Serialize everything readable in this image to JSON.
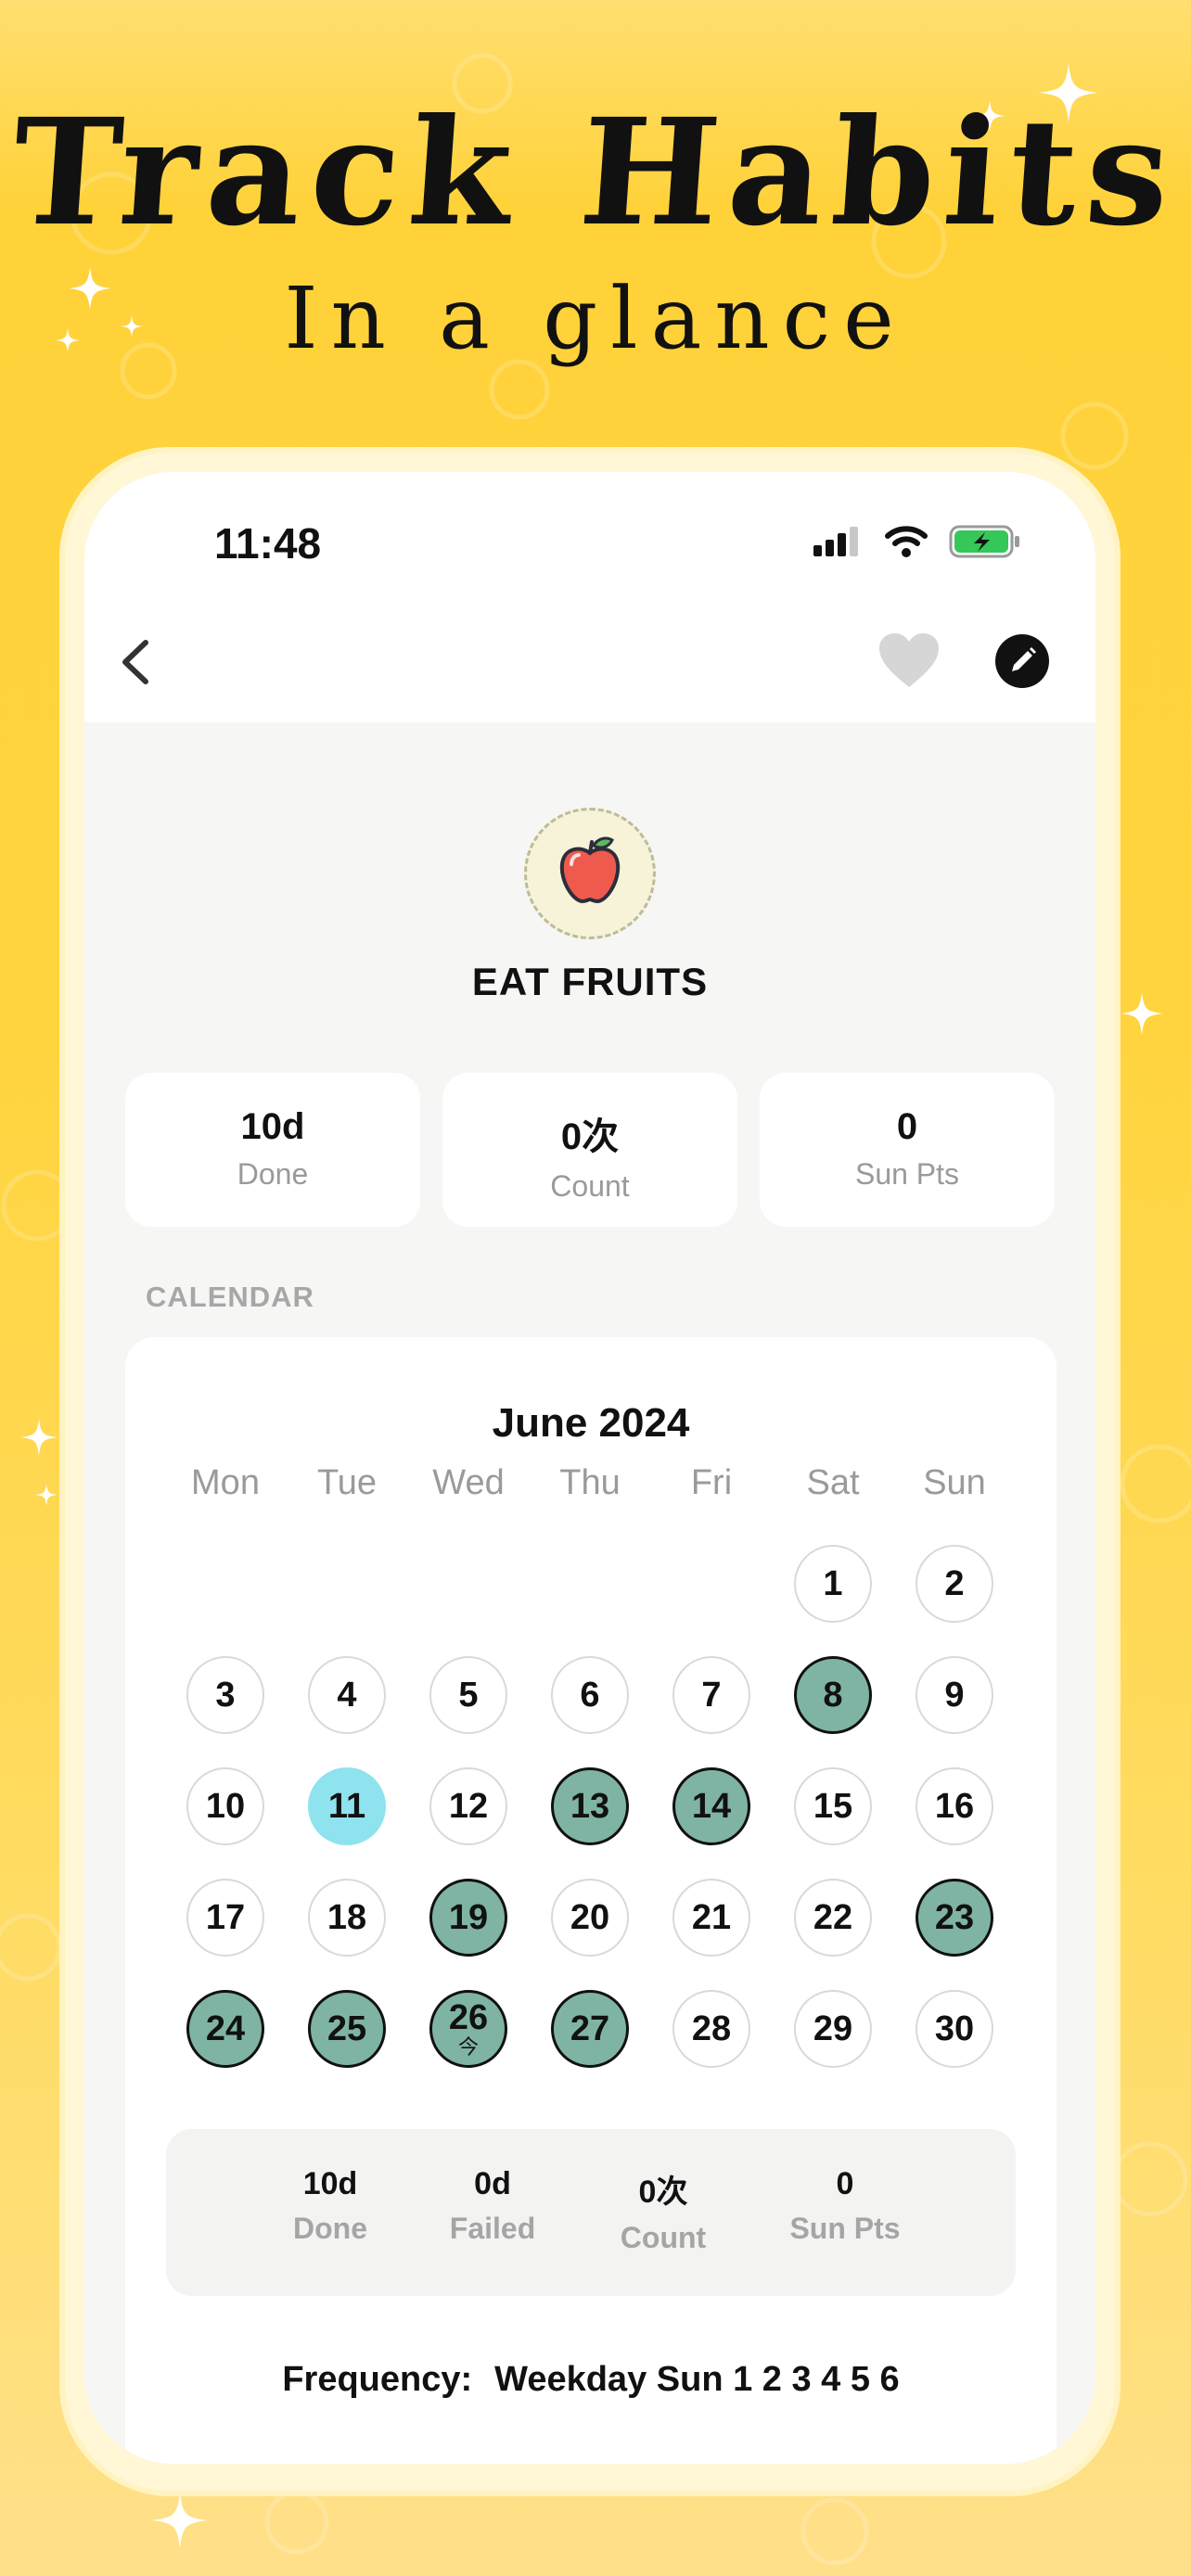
{
  "promo": {
    "headline": "Track Habits",
    "subheadline": "In a glance"
  },
  "status_bar": {
    "time": "11:48"
  },
  "nav": {
    "back_icon": "chevron-left-icon",
    "favorite_icon": "heart-icon",
    "edit_icon": "pencil-icon"
  },
  "habit": {
    "icon": "apple-icon",
    "name": "EAT FRUITS"
  },
  "stats": [
    {
      "value": "10d",
      "label": "Done"
    },
    {
      "value": "0次",
      "label": "Count"
    },
    {
      "value": "0",
      "label": "Sun Pts"
    }
  ],
  "calendar": {
    "section_label": "CALENDAR",
    "month_title": "June 2024",
    "weekdays": [
      "Mon",
      "Tue",
      "Wed",
      "Thu",
      "Fri",
      "Sat",
      "Sun"
    ],
    "days": [
      {
        "n": "1"
      },
      {
        "n": "2"
      },
      {
        "n": "3"
      },
      {
        "n": "4"
      },
      {
        "n": "5"
      },
      {
        "n": "6"
      },
      {
        "n": "7"
      },
      {
        "n": "8"
      },
      {
        "n": "9"
      },
      {
        "n": "10"
      },
      {
        "n": "11"
      },
      {
        "n": "12"
      },
      {
        "n": "13"
      },
      {
        "n": "14"
      },
      {
        "n": "15"
      },
      {
        "n": "16"
      },
      {
        "n": "17"
      },
      {
        "n": "18"
      },
      {
        "n": "19"
      },
      {
        "n": "20"
      },
      {
        "n": "21"
      },
      {
        "n": "22"
      },
      {
        "n": "23"
      },
      {
        "n": "24"
      },
      {
        "n": "25"
      },
      {
        "n": "26",
        "sub": "今"
      },
      {
        "n": "27"
      },
      {
        "n": "28"
      },
      {
        "n": "29"
      },
      {
        "n": "30"
      }
    ],
    "done_days": [
      "8",
      "13",
      "14",
      "19",
      "23",
      "24",
      "25",
      "26",
      "27"
    ],
    "today": "11",
    "summary": [
      {
        "value": "10d",
        "label": "Done"
      },
      {
        "value": "0d",
        "label": "Failed"
      },
      {
        "value": "0次",
        "label": "Count"
      },
      {
        "value": "0",
        "label": "Sun Pts"
      }
    ],
    "frequency_label": "Frequency:",
    "frequency_value": "Weekday Sun 1 2 3 4 5 6"
  },
  "colors": {
    "background": "#ffd43e",
    "done_day": "#7fb4a4",
    "today_day": "#8ee3ee",
    "battery": "#35c759"
  }
}
